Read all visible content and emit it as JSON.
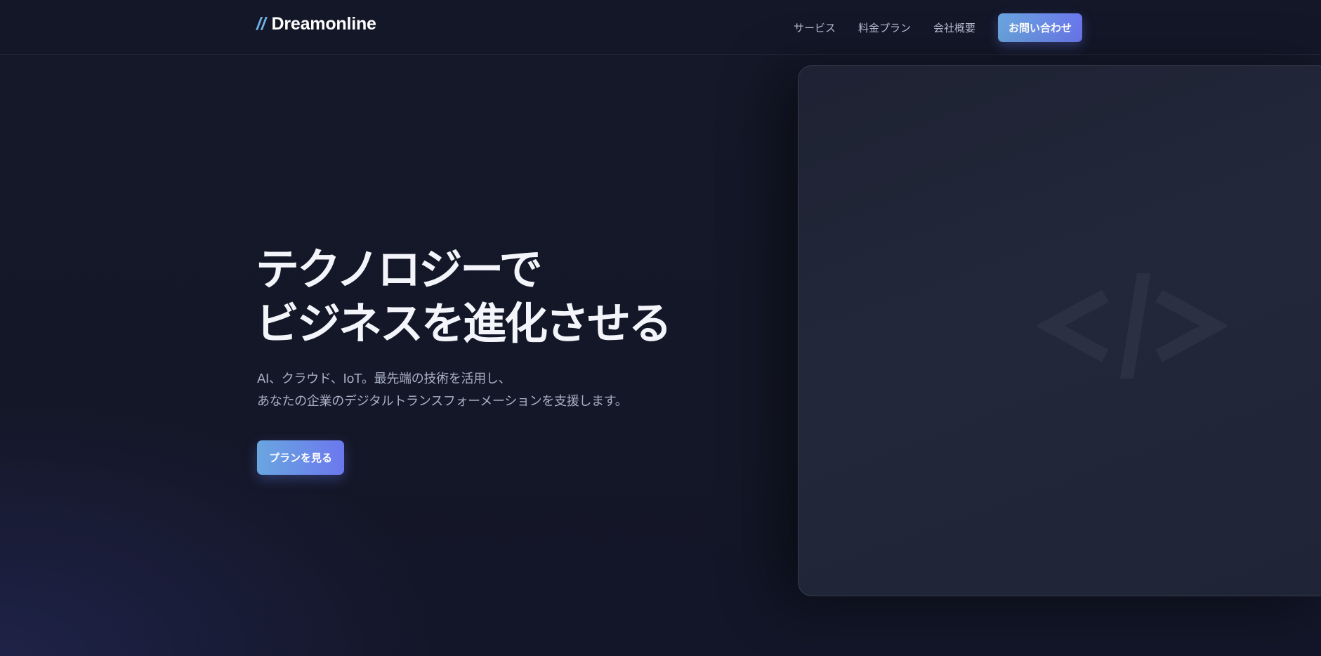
{
  "header": {
    "brand_mark": "//",
    "brand_name": "Dreamonline",
    "nav": [
      {
        "label": "サービス"
      },
      {
        "label": "料金プラン"
      },
      {
        "label": "会社概要"
      }
    ],
    "cta_label": "お問い合わせ"
  },
  "hero": {
    "title_line1": "テクノロジーで",
    "title_line2": "ビジネスを進化させる",
    "sub_line1": "AI、クラウド、IoT。最先端の技術を活用し、",
    "sub_line2": "あなたの企業のデジタルトランスフォーメーションを支援します。",
    "button_label": "プランを見る"
  },
  "visual": {
    "icon": "code-icon"
  },
  "colors": {
    "background": "#13172a",
    "accent_start": "#6aa6e0",
    "accent_end": "#6b78ee",
    "brand_mark": "#6fb0e6"
  }
}
